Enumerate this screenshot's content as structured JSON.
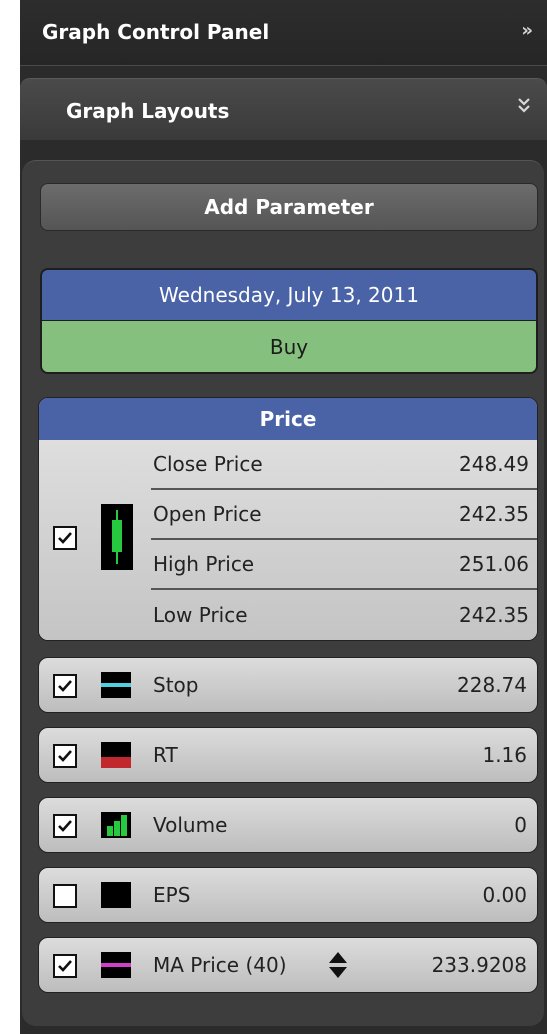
{
  "header": {
    "title": "Graph Control Panel",
    "collapse_glyph": "»"
  },
  "layouts": {
    "title": "Graph Layouts",
    "expand_glyph": "︾"
  },
  "add_parameter": {
    "label": "Add Parameter"
  },
  "status": {
    "date": "Wednesday, July 13, 2011",
    "signal": "Buy",
    "signal_color": "#86c07e",
    "date_color": "#4a63a6"
  },
  "price": {
    "title": "Price",
    "checked": true,
    "rows": [
      {
        "label": "Close Price",
        "value": "248.49"
      },
      {
        "label": "Open Price",
        "value": "242.35"
      },
      {
        "label": "High Price",
        "value": "251.06"
      },
      {
        "label": "Low Price",
        "value": "242.35"
      }
    ],
    "swatch_icon": "candlestick-icon",
    "swatch_color": "#27c93f"
  },
  "params": [
    {
      "label": "Stop",
      "value": "228.74",
      "checked": true,
      "icon": "line-swatch-icon",
      "color": "#4fd0e0"
    },
    {
      "label": "RT",
      "value": "1.16",
      "checked": true,
      "icon": "bar-swatch-icon",
      "color": "#c0282e"
    },
    {
      "label": "Volume",
      "value": "0",
      "checked": true,
      "icon": "volume-bars-icon",
      "color": "#27c93f"
    },
    {
      "label": "EPS",
      "value": "0.00",
      "checked": false,
      "icon": "black-swatch-icon",
      "color": "#000000"
    },
    {
      "label": "MA Price (40)",
      "value": "233.9208",
      "checked": true,
      "icon": "line-swatch-icon",
      "color": "#d040c8"
    }
  ]
}
